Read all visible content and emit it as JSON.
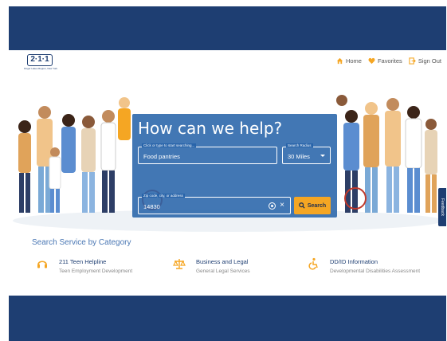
{
  "logo": {
    "text": "2·1·1",
    "tagline": "Finger Lakes Region, New York"
  },
  "nav": {
    "home": "Home",
    "favorites": "Favorites",
    "sign_out": "Sign Out"
  },
  "search": {
    "title": "How can we help?",
    "query_label": "Click or type to start searching...",
    "query_value": "Food pantries",
    "radius_label": "Search Radius",
    "radius_value": "30 Miles",
    "location_label": "Zip code, city, or address",
    "location_value": "14830",
    "button": "Search"
  },
  "feedback": "Feedback",
  "categories_heading": "Search Service by Category",
  "categories": [
    {
      "title": "211 Teen Helpline",
      "sub": "Teen Employment Development",
      "icon": "headset-icon"
    },
    {
      "title": "Business and Legal",
      "sub": "General Legal Services",
      "icon": "scales-icon"
    },
    {
      "title": "DD/ID Information",
      "sub": "Developmental Disabilities Assessment",
      "icon": "wheelchair-icon"
    }
  ],
  "colors": {
    "brand_navy": "#1e3e72",
    "accent_orange": "#f5a623",
    "card_blue": "#2864aa"
  }
}
